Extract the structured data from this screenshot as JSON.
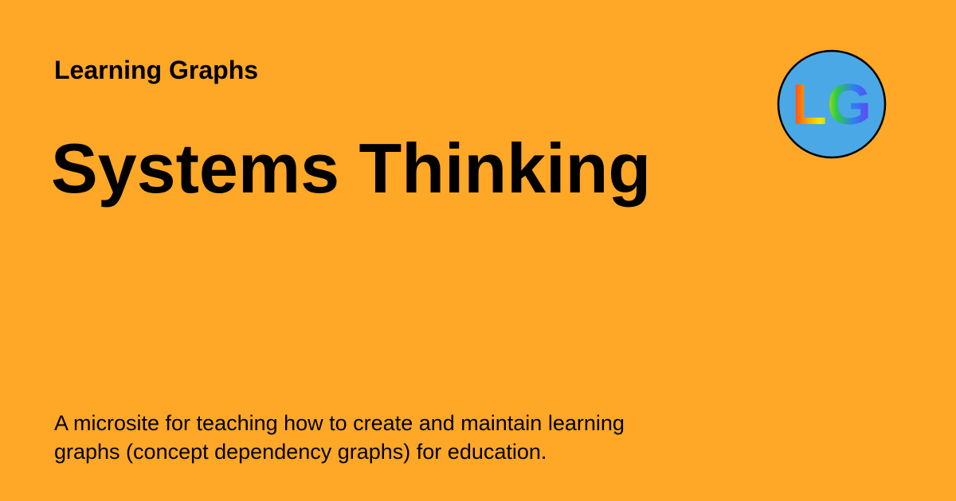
{
  "card": {
    "site_name": "Learning Graphs",
    "title": "Systems Thinking",
    "description": "A microsite for teaching how to create and maintain learning graphs (concept dependency graphs) for education."
  },
  "logo": {
    "text": "LG",
    "icon": "learning-graphs-logo",
    "fill_color": "#4aa8e6",
    "border_color": "#000000"
  },
  "colors": {
    "background": "#ffa726",
    "text": "#000000"
  }
}
